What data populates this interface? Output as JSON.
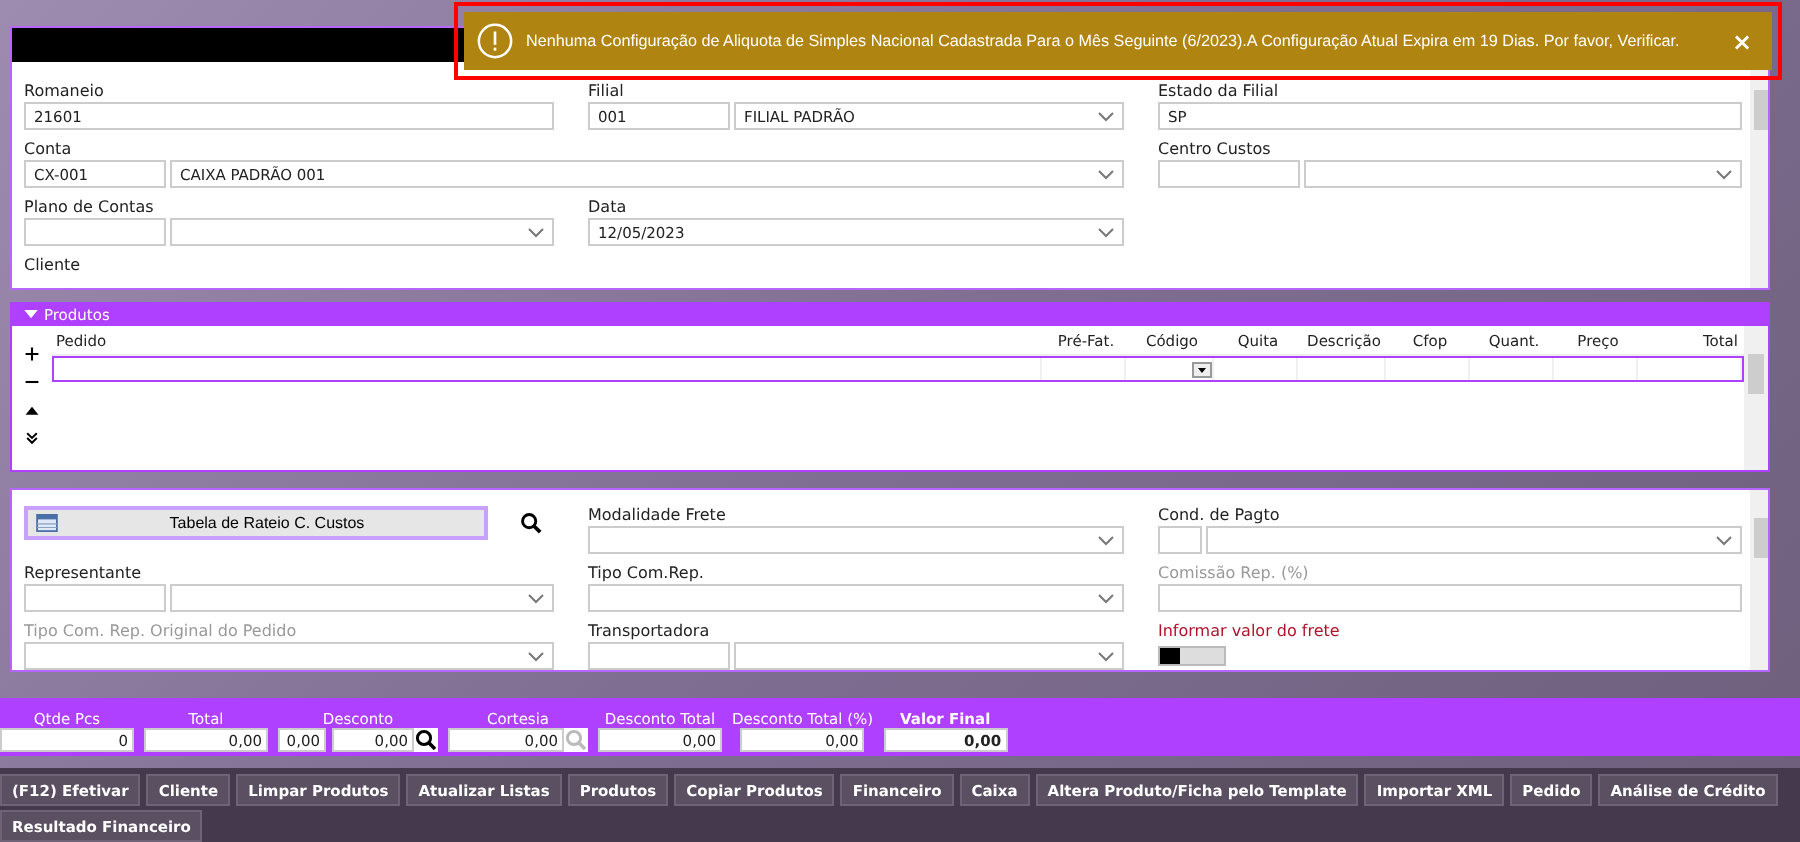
{
  "toast": {
    "message": "Nenhuma Configuração de Aliquota de Simples Nacional Cadastrada Para o Mês Seguinte (6/2023).A Configuração Atual Expira em 19 Dias. Por favor, Verificar.",
    "close": "×"
  },
  "top_form": {
    "rows": [
      {
        "cells": [
          {
            "label": "Romaneio",
            "inputs": [
              {
                "kind": "text",
                "value": "21601"
              }
            ]
          },
          {
            "label": "Filial",
            "inputs": [
              {
                "kind": "code",
                "value": "001"
              },
              {
                "kind": "select",
                "value": "FILIAL PADRÃO"
              }
            ]
          },
          {
            "label": "Estado da Filial",
            "inputs": [
              {
                "kind": "text",
                "value": "SP"
              }
            ]
          }
        ]
      },
      {
        "cells": [
          {
            "label": "Conta",
            "inputs": [
              {
                "kind": "code",
                "value": "CX-001"
              },
              {
                "kind": "select",
                "value": "CAIXA PADRÃO 001"
              }
            ]
          },
          "",
          {
            "label": "Centro Custos",
            "inputs": [
              {
                "kind": "code"
              },
              {
                "kind": "select"
              }
            ]
          }
        ]
      },
      {
        "cells": [
          {
            "label": "Plano de Contas",
            "inputs": [
              {
                "kind": "code"
              },
              {
                "kind": "select"
              }
            ]
          },
          {
            "label": "Data",
            "inputs": [
              {
                "kind": "select",
                "value": "12/05/2023"
              }
            ]
          }
        ]
      },
      {
        "cells": [
          {
            "label": "Cliente"
          }
        ]
      }
    ]
  },
  "products": {
    "title": "Produtos",
    "columns": [
      "Pedido",
      "Pré-Fat.",
      "Código",
      "Quita",
      "Descrição",
      "Cfop",
      "Quant.",
      "Preço",
      "Total"
    ]
  },
  "bottom_form": {
    "rows": [
      {
        "cells": [
          {
            "kind": "button",
            "label": "Tabela de Rateio C. Custos"
          },
          {
            "label": "Modalidade Frete",
            "inputs": [
              {
                "kind": "select"
              }
            ]
          },
          {
            "label": "Cond. de Pagto",
            "inputs": [
              {
                "kind": "short"
              },
              {
                "kind": "select"
              }
            ]
          }
        ]
      },
      {
        "cells": [
          {
            "label": "Representante",
            "inputs": [
              {
                "kind": "code"
              },
              {
                "kind": "select"
              }
            ]
          },
          {
            "label": "Tipo Com.Rep.",
            "inputs": [
              {
                "kind": "select"
              }
            ]
          },
          {
            "label": "Comissão Rep. (%)",
            "disabled": true,
            "inputs": [
              {
                "kind": "text"
              }
            ]
          }
        ]
      },
      {
        "cells": [
          {
            "label": "Tipo Com. Rep. Original do Pedido",
            "disabled": true,
            "inputs": [
              {
                "kind": "select"
              }
            ]
          },
          {
            "label": "Transportadora",
            "inputs": [
              {
                "kind": "code"
              },
              {
                "kind": "select"
              }
            ]
          },
          {
            "label": "Informar valor do frete",
            "kind": "toggle",
            "alert": true,
            "on": false
          }
        ]
      }
    ]
  },
  "totals": [
    {
      "label": "Qtde Pcs",
      "boxes": [
        "0"
      ]
    },
    {
      "label": "Total",
      "boxes": [
        "0,00"
      ]
    },
    {
      "label": "Desconto",
      "boxes": [
        "0,00",
        "0,00"
      ],
      "lookup": true
    },
    {
      "label": "Cortesia",
      "boxes": [
        "0,00"
      ],
      "lookup": true,
      "lookup_disabled": true
    },
    {
      "label": "Desconto Total",
      "boxes": [
        "0,00"
      ]
    },
    {
      "label": "Desconto Total (%)",
      "boxes": [
        "0,00"
      ]
    },
    {
      "label": "Valor Final",
      "boxes": [
        "0,00"
      ],
      "bold": true
    }
  ],
  "actions": [
    "(F12) Efetivar",
    "Cliente",
    "Limpar Produtos",
    "Atualizar Listas",
    "Produtos",
    "Copiar Produtos",
    "Financeiro",
    "Caixa",
    "Altera Produto/Ficha pelo Template",
    "Importar XML",
    "Pedido",
    "Análise de Crédito",
    "Resultado Financeiro"
  ]
}
